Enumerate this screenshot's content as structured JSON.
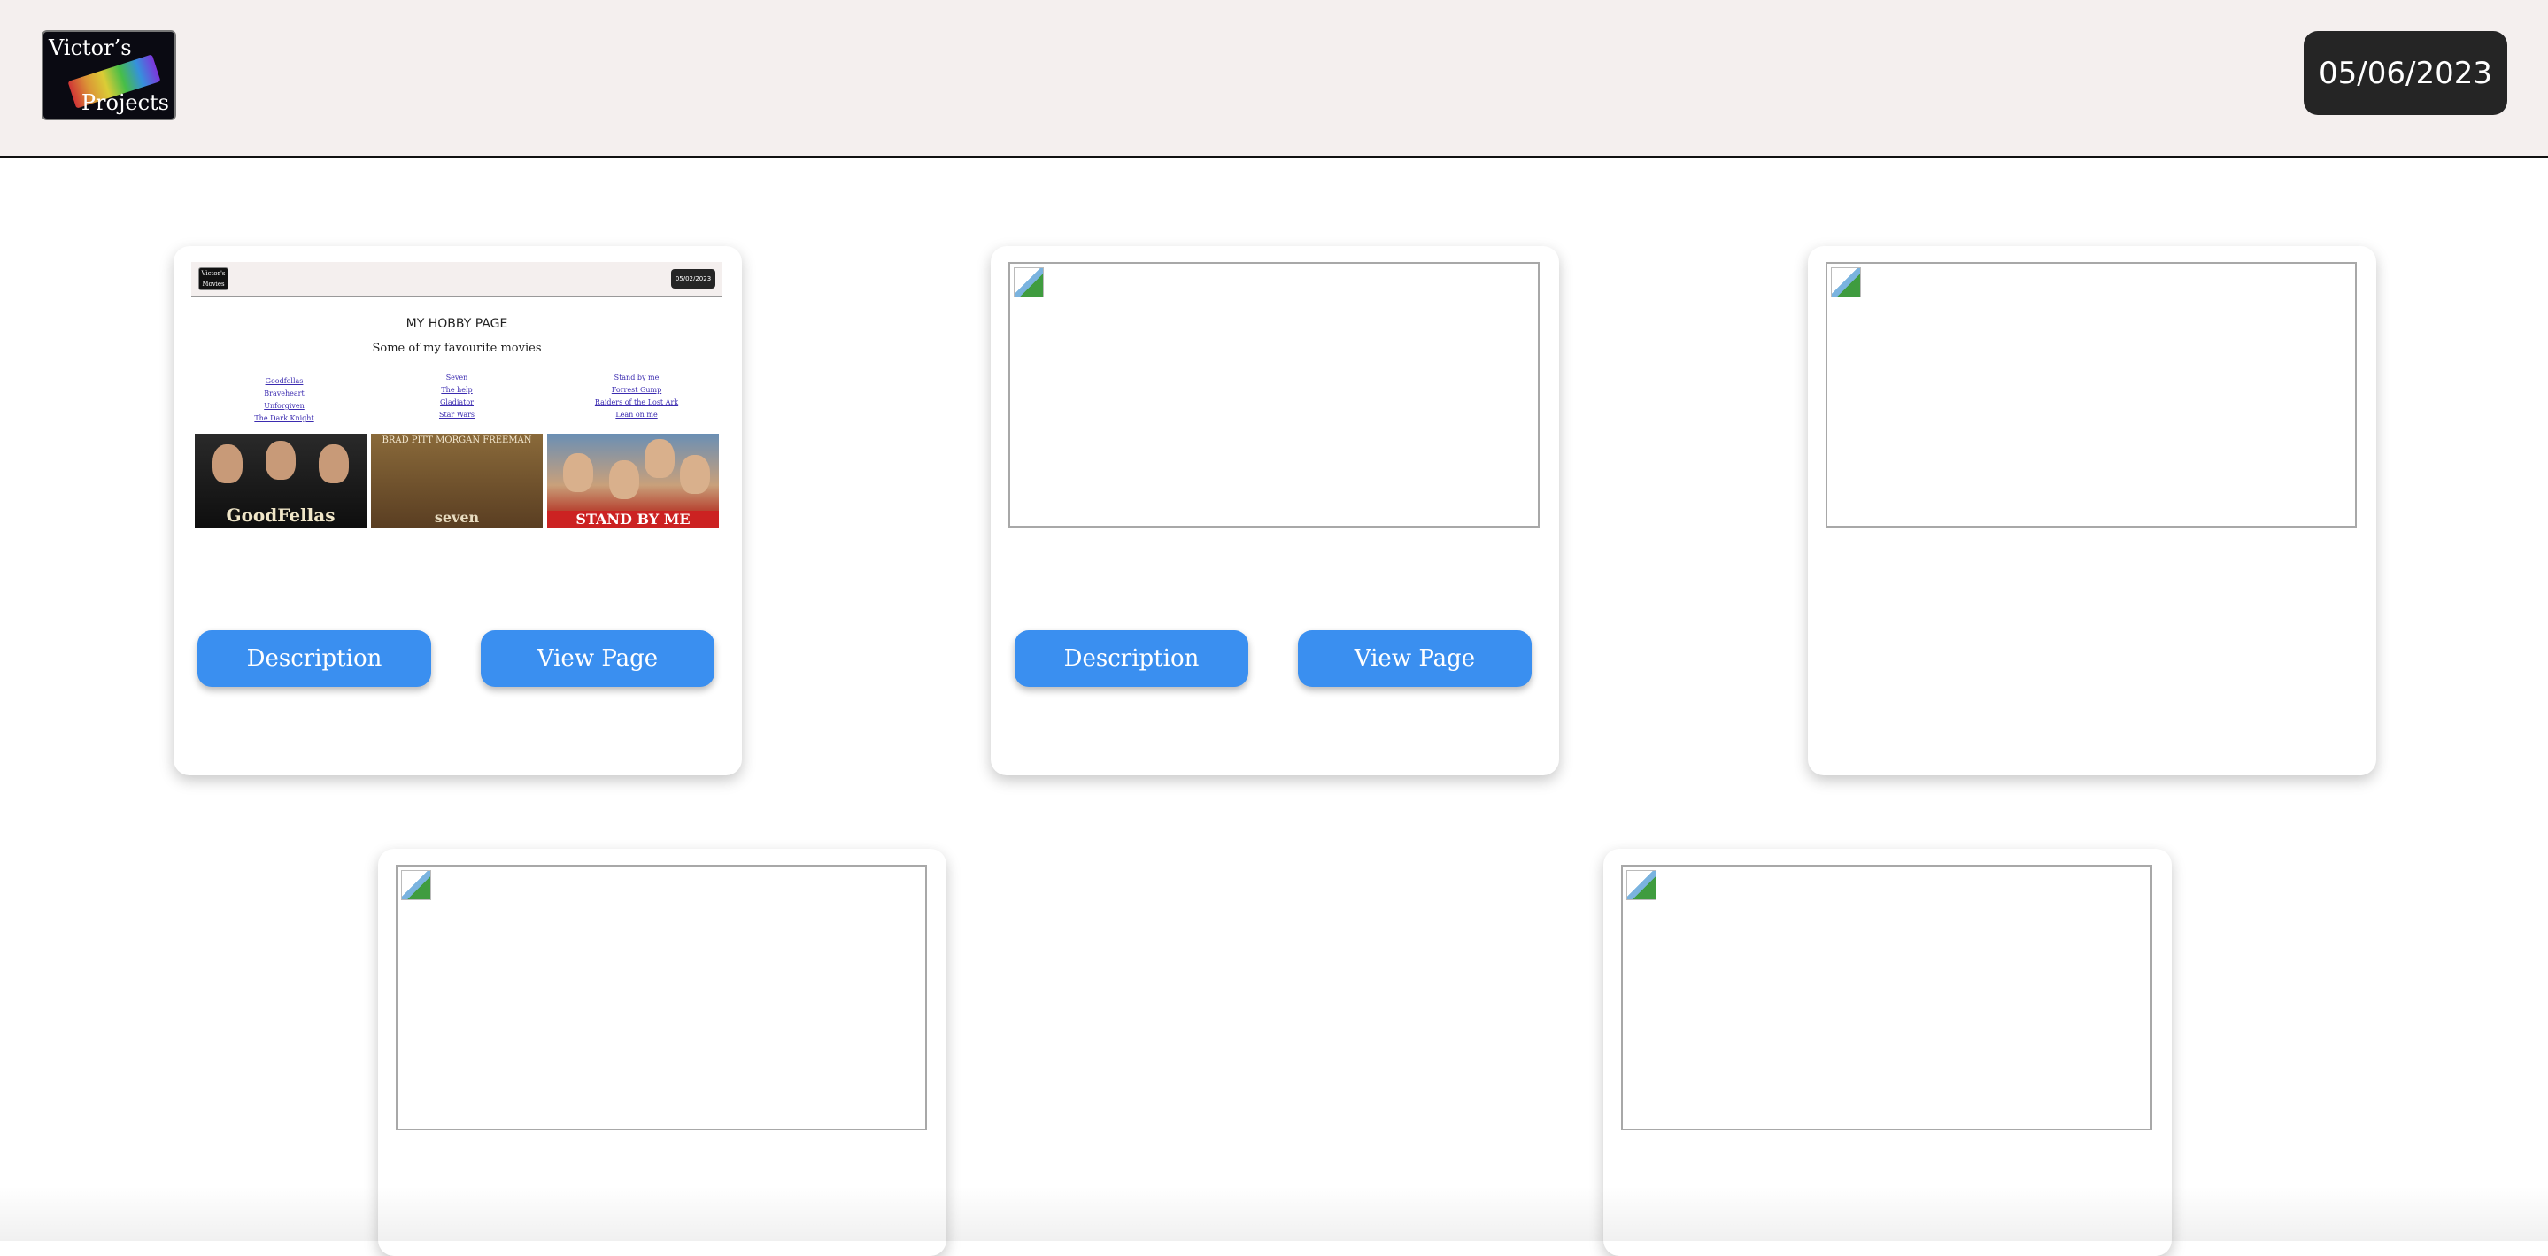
{
  "header": {
    "logo": {
      "line1": "Victor’s",
      "line2": "Projects"
    },
    "date": "05/06/2023"
  },
  "cards": [
    {
      "preview": {
        "logo_text": "Victor's Movies",
        "date": "05/02/2023",
        "title": "MY HOBBY PAGE",
        "subtitle": "Some of my favourite movies",
        "columns": [
          [
            "Goodfellas",
            "Braveheart",
            "Unforgiven",
            "The Dark Knight"
          ],
          [
            "Seven",
            "The help",
            "Gladiator",
            "Star Wars"
          ],
          [
            "Stand by me",
            "Forrest Gump",
            "Raiders of the Lost Ark",
            "Lean on me"
          ]
        ],
        "posters": [
          "GoodFellas",
          "seven",
          "STAND BY ME"
        ],
        "poster_top": "BRAD PITT    MORGAN FREEMAN"
      },
      "description_label": "Description",
      "view_label": "View Page"
    },
    {
      "description_label": "Description",
      "view_label": "View Page"
    }
  ]
}
